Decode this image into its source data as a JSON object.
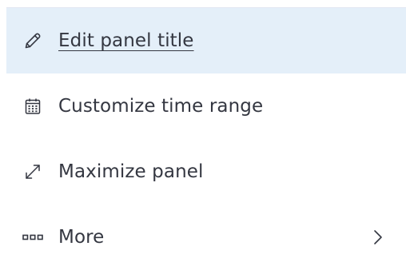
{
  "menu": {
    "items": [
      {
        "label": "Edit panel title",
        "icon": "pencil-icon",
        "active": true
      },
      {
        "label": "Customize time range",
        "icon": "calendar-icon",
        "active": false
      },
      {
        "label": "Maximize panel",
        "icon": "expand-icon",
        "active": false
      },
      {
        "label": "More",
        "icon": "more-dots-icon",
        "active": false,
        "has_submenu": true
      }
    ],
    "colors": {
      "text": "#343741",
      "active_background": "#e4eff9",
      "border": "#e3e8f2"
    }
  }
}
